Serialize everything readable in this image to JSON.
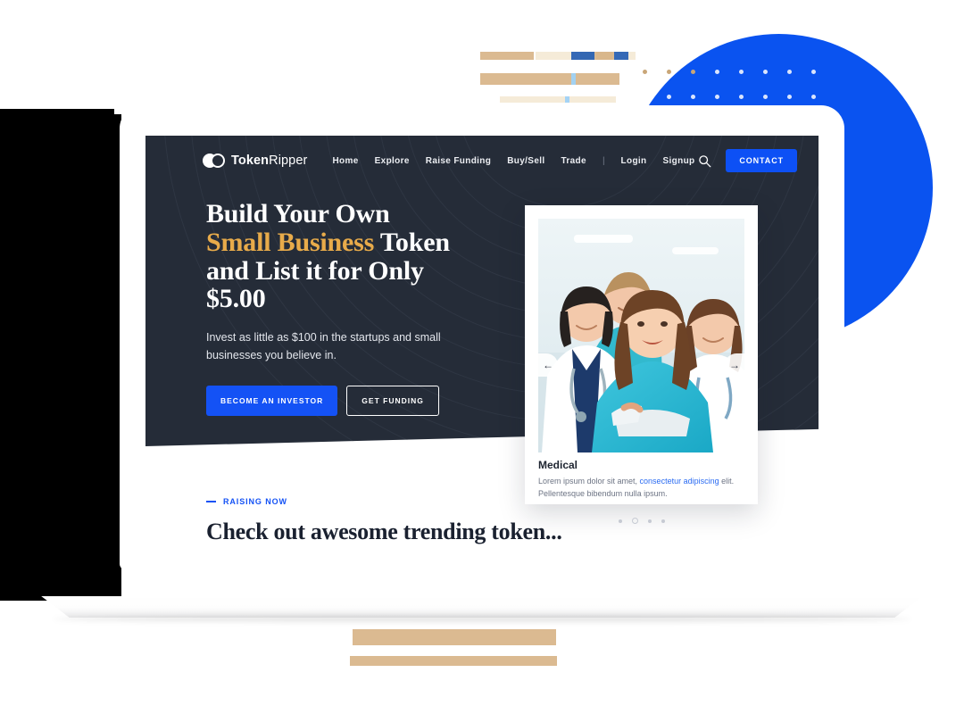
{
  "brand": {
    "name_bold": "Token",
    "name_light": "Ripper",
    "logo_icon": "two-overlapping-circles-icon",
    "accent_blue": "#0d50f5",
    "accent_gold": "#e8ab4a",
    "hero_bg": "#252c38"
  },
  "nav": {
    "links": [
      {
        "label": "Home"
      },
      {
        "label": "Explore"
      },
      {
        "label": "Raise Funding"
      },
      {
        "label": "Buy/Sell"
      },
      {
        "label": "Trade"
      },
      {
        "label": "|"
      },
      {
        "label": "Login"
      },
      {
        "label": "Signup"
      }
    ],
    "search_icon": "search-icon",
    "contact_label": "CONTACT"
  },
  "hero": {
    "title_line1": "Build Your Own",
    "title_highlight": "Small Business",
    "title_line2_rest": " Token",
    "title_line3": "and List it for Only",
    "title_line4": "$5.00",
    "subtitle": "Invest as little as $100 in the startups and small businesses you believe in.",
    "primary_button": "BECOME AN INVESTOR",
    "secondary_button": "GET FUNDING"
  },
  "card": {
    "title": "Medical",
    "desc_before": "Lorem ipsum dolor sit amet, ",
    "desc_link": "consectetur adipiscing",
    "desc_after": " elit. Pellentesque bibendum nulla ipsum.",
    "prev_icon": "arrow-left-icon",
    "next_icon": "arrow-right-icon",
    "prev_glyph": "←",
    "next_glyph": "→",
    "photo_alt": "medical-team-photo",
    "dots": [
      {
        "active": false
      },
      {
        "active": true
      },
      {
        "active": false
      },
      {
        "active": false
      }
    ]
  },
  "raising": {
    "eyebrow": "RAISING NOW",
    "heading": "Check out awesome trending token..."
  }
}
